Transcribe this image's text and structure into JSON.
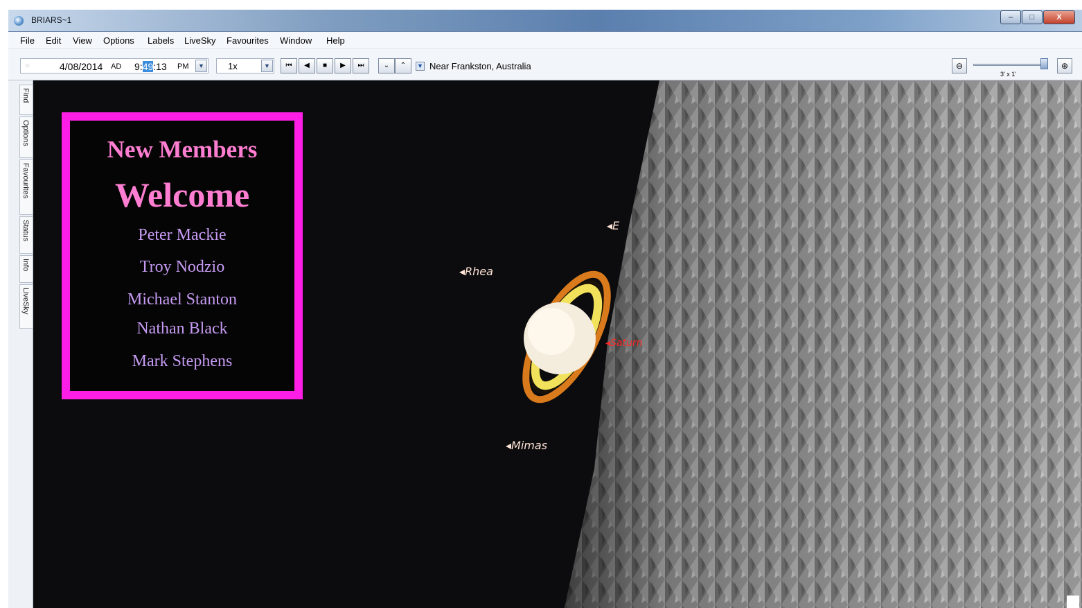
{
  "window": {
    "title": "BRIARS~1",
    "min_label": "–",
    "max_label": "□",
    "close_label": "X"
  },
  "menu": [
    "File",
    "Edit",
    "View",
    "Options",
    "Labels",
    "LiveSky",
    "Favourites",
    "Window",
    "Help"
  ],
  "toolbar": {
    "date": "4/08/2014",
    "era": "AD",
    "time_prefix": "9:",
    "time_selected": "49",
    "time_suffix": ":13",
    "ampm": "PM",
    "rate": "1x",
    "step_back_fast": "⏮",
    "step_back": "◀",
    "stop": "■",
    "step_forward": "▶",
    "step_forward_fast": "⏭",
    "location": "Near Frankston, Australia",
    "fov": "3' x 1'"
  },
  "sidetabs": [
    "Find",
    "Options",
    "Favourites",
    "Status",
    "Info",
    "LiveSky"
  ],
  "welcome": {
    "heading1": "New Members",
    "heading2": "Welcome",
    "members": [
      "Peter Mackie",
      "Troy Nodzio",
      "Michael Stanton",
      "Nathan Black",
      "Mark Stephens"
    ]
  },
  "labels": {
    "rhea": "◂Rhea",
    "mimas": "◂Mimas",
    "e": "◂E",
    "saturn": "◂Saturn"
  },
  "colors": {
    "frame": "#ff1ee6",
    "heading": "#ff7ed2",
    "member": "#c69bf3",
    "sky": "#0c0c0e"
  }
}
